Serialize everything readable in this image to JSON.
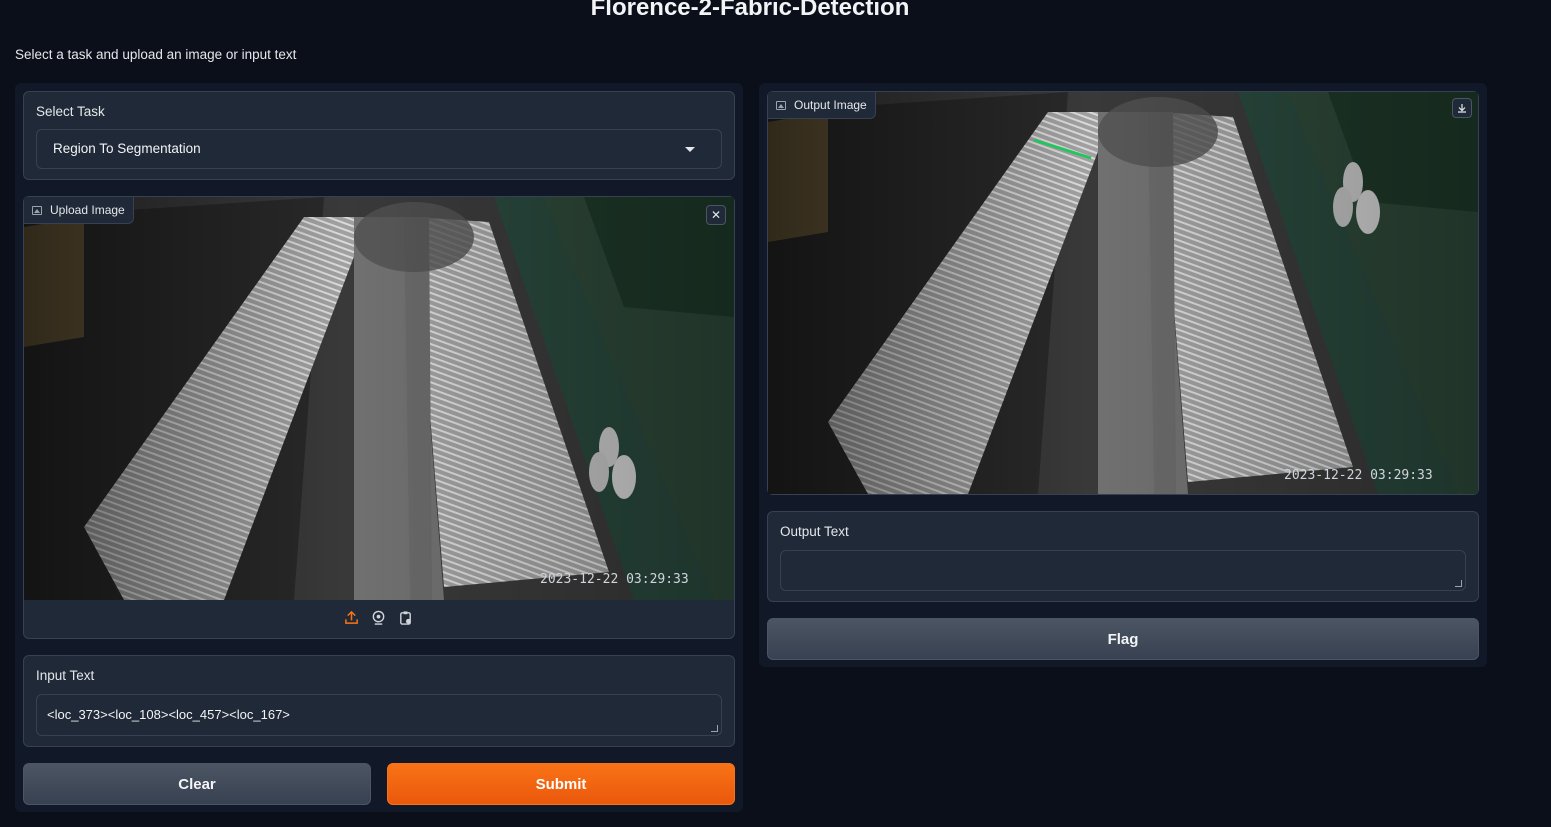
{
  "app": {
    "title": "Florence-2-Fabric-Detection",
    "description": "Select a task and upload an image or input text"
  },
  "task": {
    "label": "Select Task",
    "selected": "Region To Segmentation"
  },
  "upload_image": {
    "label": "Upload Image",
    "timestamp": "2023-12-22 03:29:33",
    "source_icons": [
      "upload-icon",
      "webcam-icon",
      "clipboard-icon"
    ]
  },
  "input_text": {
    "label": "Input Text",
    "value": "<loc_373><loc_108><loc_457><loc_167>"
  },
  "buttons": {
    "clear": "Clear",
    "submit": "Submit",
    "flag": "Flag"
  },
  "output_image": {
    "label": "Output Image",
    "timestamp": "2023-12-22 03:29:33"
  },
  "output_text": {
    "label": "Output Text",
    "value": ""
  },
  "colors": {
    "background": "#0b0f19",
    "panel": "#1f2937",
    "accent": "#f97316",
    "segmentation_line": "#22c55e"
  }
}
